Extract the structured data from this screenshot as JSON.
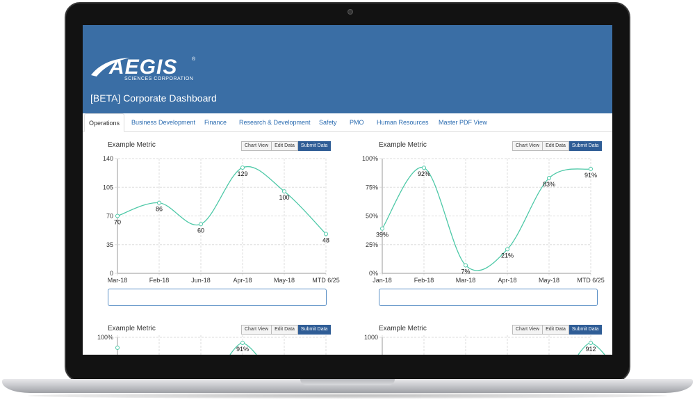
{
  "app": {
    "logo_text": "AEGIS",
    "logo_reg": "®",
    "logo_subtext": "SCIENCES CORPORATION",
    "title": "[BETA] Corporate Dashboard",
    "header_color": "#3a6ea5",
    "accent_color": "#4fc9a8"
  },
  "tabs": [
    {
      "label": "Operations",
      "active": true
    },
    {
      "label": "Business Development"
    },
    {
      "label": "Finance"
    },
    {
      "label": "Research & Development"
    },
    {
      "label": "Safety"
    },
    {
      "label": "PMO"
    },
    {
      "label": "Human Resources"
    },
    {
      "label": "Master PDF View"
    }
  ],
  "buttons": {
    "chart_view": "Chart View",
    "edit_data": "Edit Data",
    "submit_data": "Submit Data"
  },
  "panels": [
    {
      "title": "Example Metric"
    },
    {
      "title": "Example Metric"
    },
    {
      "title": "Example Metric"
    },
    {
      "title": "Example Metric"
    }
  ],
  "chart_data": [
    {
      "type": "line",
      "categories": [
        "Mar-18",
        "Feb-18",
        "Jun-18",
        "Apr-18",
        "May-18",
        "MTD 6/25"
      ],
      "values": [
        70,
        86,
        60,
        129,
        100,
        48
      ],
      "labels": [
        "70",
        "86",
        "60",
        "129",
        "100",
        "48"
      ],
      "yticks": [
        "0",
        "35",
        "70",
        "105",
        "140"
      ],
      "ylim": [
        0,
        140
      ],
      "grid": true
    },
    {
      "type": "line",
      "categories": [
        "Jan-18",
        "Feb-18",
        "Mar-18",
        "Apr-18",
        "May-18",
        "MTD 6/25"
      ],
      "values": [
        39,
        92,
        7,
        21,
        83,
        91
      ],
      "labels": [
        "39%",
        "92%",
        "7%",
        "21%",
        "83%",
        "91%"
      ],
      "yticks": [
        "0%",
        "25%",
        "50%",
        "75%",
        "100%"
      ],
      "ylim": [
        0,
        100
      ],
      "grid": true
    },
    {
      "type": "line",
      "partial": true,
      "yticks_visible": [
        "100%"
      ],
      "ylim": [
        0,
        100
      ],
      "values_visible": [
        {
          "index": 3,
          "label": "91%",
          "value": 91
        }
      ],
      "grid": true
    },
    {
      "type": "line",
      "partial": true,
      "yticks_visible": [
        "1000"
      ],
      "values_visible": [
        {
          "index": 5,
          "label": "912",
          "value": 912
        }
      ],
      "grid": true
    }
  ]
}
